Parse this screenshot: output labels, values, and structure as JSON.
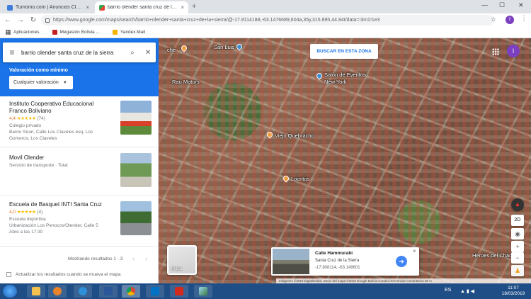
{
  "browser": {
    "tabs": [
      {
        "label": "Tumomo.com | Anuncios Clasifi",
        "close": "×"
      },
      {
        "label": "barrio olender santa cruz de la s",
        "close": "×"
      }
    ],
    "new_tab": "+",
    "window_controls": {
      "minimize": "—",
      "maximize": "☐",
      "close": "✕"
    },
    "url": "https://www.google.com/maps/search/barrio+olender+santa+cruz+de+la+sierra/@-17.8114188,-63.1476689,604a,35y,315.89h,44.84t/data=!3m1!1e3",
    "profile_initial": "I",
    "bookmarks": [
      {
        "label": "Aplicaciones",
        "color": "#5f6368"
      },
      {
        "label": "Megasión Bolivia ...",
        "color": "#c5221f"
      },
      {
        "label": "Yandex.Mail",
        "color": "#f4b400"
      }
    ]
  },
  "panel": {
    "search_query": "barrio olender santa cruz de la sierra",
    "filter_label": "Valoración como mínimo",
    "filter_value": "Cualquier valoración",
    "results": [
      {
        "name_line1": "Instituto Cooperativo Educacional",
        "name_line2": "Franco Boliviano",
        "rating": "4,4",
        "stars": "★★★★★",
        "reviews": "(74)",
        "category": "Colegio privado",
        "address_line1": "Barrio Sirari, Calle Los Claveles esq. Los",
        "address_line2": "Gomeros, Los Claveles"
      },
      {
        "name_line1": "Movil Olender",
        "category": "Servicio de transporte · Total"
      },
      {
        "name_line1": "Escuela de Basquet INTI Santa Cruz",
        "rating": "4,0",
        "stars": "★★★★★",
        "reviews": "(4)",
        "category": "Escuela deportiva",
        "address_line1": "Urbanización Los Penocos/Olender, Calle 5",
        "hours": "Abre a las 17:30"
      }
    ],
    "showing": "Mostrando resultados 1 - 3",
    "prev": "‹",
    "next": "›",
    "update_checkbox": "Actualizar los resultados cuando se mueva el mapa"
  },
  "map": {
    "search_area_button": "BUSCAR EN ESTA ZONA",
    "avatar_initial": "I",
    "labels": {
      "top_left": "che",
      "san_luis": "San Luis",
      "rau_motors": "Rau Motors",
      "salon": "Salón de Eventos",
      "new_york": "New York",
      "viejo_quebracho": "Viejo Quebracho",
      "locrito": "Locritos",
      "heroes": "Heroes del Chaco"
    },
    "controls": {
      "two_d": "2D",
      "plus": "+",
      "minus": "−",
      "compass": "▲",
      "locate": "◉",
      "pegman": "♟"
    },
    "map_toggle": "Mapa",
    "street_view": {
      "title": "Calle Hammurabi",
      "subtitle": "Santa Cruz de la Sierra",
      "coords": "-17.808114, -63.149601",
      "close": "×",
      "arrow": "➔"
    },
    "attribution": "Imágenes ©2019 DigitalGlobe, Datos del mapa ©2019 Google   Bolivia   Condiciones   Enviar comentarios   50 m"
  },
  "taskbar": {
    "language": "ES",
    "tray": "▲ ▮ ◀",
    "time": "11:07",
    "date": "18/03/2019"
  }
}
